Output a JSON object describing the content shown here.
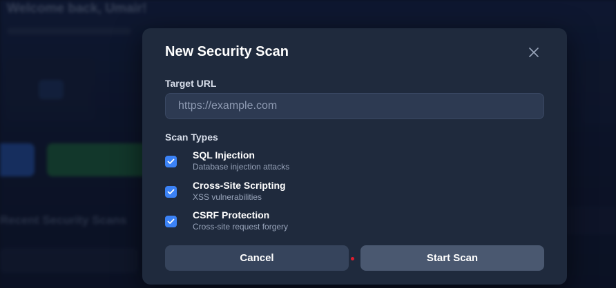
{
  "background": {
    "greeting": "Welcome back, Umair!",
    "section_title": "Recent Security Scans"
  },
  "modal": {
    "title": "New Security Scan",
    "close_icon": "close-icon",
    "target_url": {
      "label": "Target URL",
      "placeholder": "https://example.com",
      "value": ""
    },
    "scan_types": {
      "label": "Scan Types",
      "items": [
        {
          "title": "SQL Injection",
          "description": "Database injection attacks",
          "checked": true
        },
        {
          "title": "Cross-Site Scripting",
          "description": "XSS vulnerabilities",
          "checked": true
        },
        {
          "title": "CSRF Protection",
          "description": "Cross-site request forgery",
          "checked": true
        }
      ]
    },
    "buttons": {
      "cancel": "Cancel",
      "start": "Start Scan"
    }
  },
  "colors": {
    "accent": "#3b82f6",
    "modal_bg": "#1f2a3d",
    "indicator": "#e11d2e"
  }
}
